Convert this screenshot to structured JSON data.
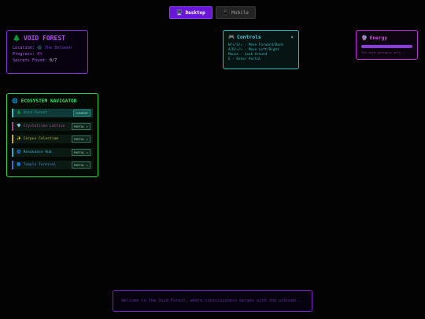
{
  "view_toggle": {
    "desktop_icon": "🖥️",
    "desktop_label": "Desktop",
    "mobile_icon": "📱",
    "mobile_label": "Mobile"
  },
  "status": {
    "icon": "🌲",
    "title": "VOID FOREST",
    "location_label": "Location:",
    "location_icon": "🌑",
    "location_value": "The Between",
    "progress_label": "Progress:",
    "progress_value": "0%",
    "secrets_label": "Secrets Found:",
    "secrets_value": "0/7"
  },
  "controls": {
    "icon": "🎮",
    "title": "Controls",
    "close": "×",
    "lines": [
      "W/↑/S/↓ - Move Forward/Back",
      "A/D/←/→ - Move Left/Right",
      "Mouse - Look Around",
      "E - Enter Portal"
    ]
  },
  "energy": {
    "icon": "🔮",
    "title": "Energy",
    "level_percent": 100,
    "note": "The void whispers only..."
  },
  "navigator": {
    "icon": "🌐",
    "title": "ECOSYSTEM NAVIGATOR",
    "items": [
      {
        "icon": "🌲",
        "label": "Void Forest",
        "badge": "CURRENT"
      },
      {
        "icon": "💎",
        "label": "Crystalline Lattice",
        "badge": "PORTAL ▸"
      },
      {
        "icon": "✨",
        "label": "Corpus Celestium",
        "badge": "PORTAL ▸"
      },
      {
        "icon": "🌀",
        "label": "Resonance Hub",
        "badge": "PORTAL ▸"
      },
      {
        "icon": "🔵",
        "label": "Temple Terminal",
        "badge": "PORTAL ▸"
      }
    ]
  },
  "message": {
    "text": "Welcome to the Void Forest, where consciousness merges with the unknown..."
  },
  "colors": {
    "accent_purple": "#6a16d6",
    "cyan": "#1ec4c4",
    "green": "#2fd84f",
    "magenta": "#c02ad6"
  }
}
